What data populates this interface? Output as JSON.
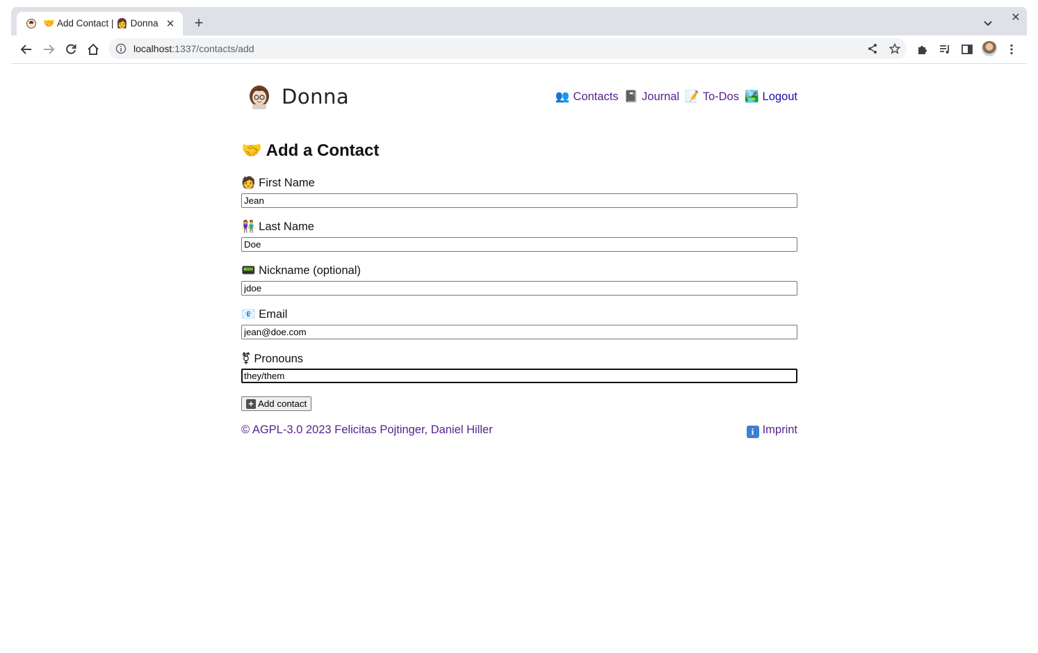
{
  "browser": {
    "tab_title": "🤝 Add Contact | 👩 Donna",
    "url_host": "localhost",
    "url_path": ":1337/contacts/add",
    "new_tab_label": "+",
    "tab_close_label": "✕",
    "window_close_label": "✕"
  },
  "site": {
    "brand": "Donna",
    "nav": [
      {
        "emoji": "👥",
        "label": "Contacts"
      },
      {
        "emoji": "📓",
        "label": "Journal"
      },
      {
        "emoji": "📝",
        "label": "To-Dos"
      },
      {
        "emoji": "🏞️",
        "label": "Logout"
      }
    ]
  },
  "form": {
    "heading_emoji": "🤝",
    "heading": "Add a Contact",
    "fields": [
      {
        "emoji": "🧑",
        "label": "First Name",
        "value": "Jean"
      },
      {
        "emoji": "👫",
        "label": "Last Name",
        "value": "Doe"
      },
      {
        "emoji": "📟",
        "label": "Nickname (optional)",
        "value": "jdoe"
      },
      {
        "emoji": "📧",
        "label": "Email",
        "value": "jean@doe.com"
      },
      {
        "emoji": "⚧",
        "label": "Pronouns",
        "value": "they/them"
      }
    ],
    "submit_icon": "+",
    "submit_label": "Add contact"
  },
  "footer": {
    "copyright": "© AGPL-3.0 2023 Felicitas Pojtinger, Daniel Hiller",
    "imprint_icon": "i",
    "imprint_label": "Imprint"
  },
  "colors": {
    "link_visited": "#55238d",
    "link": "#1a0dab",
    "chrome_tabstrip": "#dee1e6",
    "omnibox": "#f1f3f4"
  }
}
